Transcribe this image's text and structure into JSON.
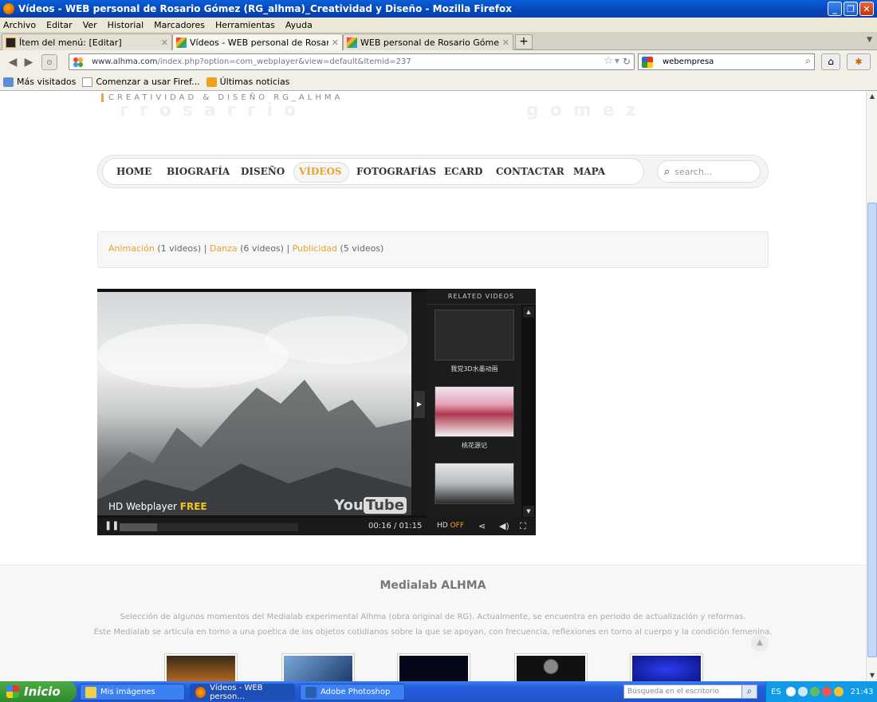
{
  "window": {
    "title": "Vídeos - WEB personal de Rosario Gómez (RG_alhma)_Creatividad y Diseño - Mozilla Firefox"
  },
  "menubar": [
    "Archivo",
    "Editar",
    "Ver",
    "Historial",
    "Marcadores",
    "Herramientas",
    "Ayuda"
  ],
  "tabs": [
    {
      "label": "Ítem del menú: [Editar]"
    },
    {
      "label": "Vídeos - WEB personal de Rosario Gómez..."
    },
    {
      "label": "WEB personal de Rosario Gómez (RG_alh..."
    }
  ],
  "navbar": {
    "url_domain": "www.alhma.com",
    "url_path": "/index.php?option=com_webplayer&view=default&Itemid=237",
    "search_value": "webempresa"
  },
  "bookmarks": [
    "Más visitados",
    "Comenzar a usar Firef...",
    "Últimas noticias"
  ],
  "site": {
    "brand": "CREATIVIDAD & DISEÑO RG_ALHMA",
    "ghost_left": "rrosarrio",
    "ghost_right": "gomez",
    "nav": [
      "HOME",
      "BIOGRAFÍA",
      "DISEÑO",
      "VÍDEOS",
      "FOTOGRAFÍAS",
      "ECARD",
      "CONTACTAR",
      "MAPA"
    ],
    "search_placeholder": "search...",
    "categories": [
      {
        "name": "Animación",
        "count": "(1 videos)"
      },
      {
        "name": "Danza",
        "count": "(6 videos)"
      },
      {
        "name": "Publicidad",
        "count": "(5 videos)"
      }
    ],
    "player": {
      "hd_label": "HD Webplayer",
      "hd_free": "FREE",
      "youtube_you": "You",
      "youtube_tube": "Tube",
      "related_header": "RELATED VIDEOS",
      "related": [
        "我党3D水墨动画",
        "桃花源记"
      ],
      "time": "00:16 / 01:15",
      "hd_toggle": "HD",
      "hd_state": "OFF",
      "played_fraction": 0.21
    },
    "footer": {
      "title": "Medialab ALHMA",
      "line1": "Selección de algunos momentos del Medialab experimental Alhma (obra original de RG). Actualmente, se encuentra en periodo de actualización y reformas.",
      "line2": "Este Medialab se articula en torno a una poetica de los objetos cotidianos sobre la que se apoyan, con frecuencia, reflexiones en torno al cuerpo y la condición femenina."
    }
  },
  "taskbar": {
    "start": "Inicio",
    "tasks": [
      "Mis imágenes",
      "Vídeos - WEB person...",
      "Adobe Photoshop"
    ],
    "desk_search": "Búsqueda en el escritorio",
    "lang": "ES",
    "clock": "21:43"
  }
}
